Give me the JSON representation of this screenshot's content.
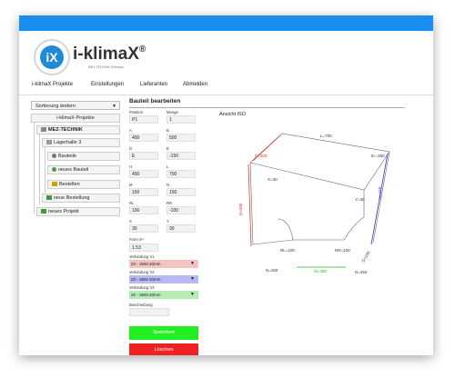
{
  "app": {
    "logo_text": "i-klimaX",
    "logo_reg": "®",
    "logo_glyph": "iX",
    "logo_subtitle": "MEZ-TECHNIK Software"
  },
  "colors": {
    "topbar": "#1a8ef0",
    "save": "#22ee22",
    "delete": "#ee2222",
    "v1": "#f6c3c3",
    "v2": "#b8b8f2",
    "v3": "#b4ecb4"
  },
  "nav": [
    "i-klimaX Projekte",
    "Einstellungen",
    "Lieferanten",
    "Abmelden"
  ],
  "sidebar": {
    "sort_label": "Sortierung ändern",
    "tree": [
      {
        "label": "i-klimaX-Projekte",
        "icon": "none"
      },
      {
        "label": "MEZ-TECHNIK",
        "icon": "building-icon"
      },
      {
        "label": "Lagerhalle 3",
        "icon": "folder-icon"
      },
      {
        "label": "Bauteile",
        "icon": "part-icon"
      },
      {
        "label": "neues Bauteil",
        "icon": "add-part-icon"
      },
      {
        "label": "Bestellen",
        "icon": "cart-icon"
      },
      {
        "label": "neue Bestellung",
        "icon": "add-order-icon"
      },
      {
        "label": "neues Projekt",
        "icon": "add-project-icon"
      }
    ]
  },
  "form": {
    "title": "Bauteil bearbeiten",
    "fields": [
      {
        "label": "Position",
        "value": "P1"
      },
      {
        "label": "Menge",
        "value": "1"
      },
      {
        "label": "A",
        "value": "400"
      },
      {
        "label": "B",
        "value": "500"
      },
      {
        "label": "D",
        "value": "E"
      },
      {
        "label": "E",
        "value": "-150"
      },
      {
        "label": "H",
        "value": "400"
      },
      {
        "label": "L",
        "value": "700"
      },
      {
        "label": "M",
        "value": "150"
      },
      {
        "label": "N",
        "value": "150"
      },
      {
        "label": "RL",
        "value": "100"
      },
      {
        "label": "RR",
        "value": "-100"
      },
      {
        "label": "X",
        "value": "30"
      },
      {
        "label": "Y",
        "value": "30"
      }
    ],
    "form_label": "Form m²",
    "form_value": "1.53",
    "v1_label": "Verbindung V1",
    "v1_value": "20 - SBM 20mm",
    "v2_label": "Verbindung V2",
    "v2_value": "20 - SBM 20mm",
    "v3_label": "Verbindung V3",
    "v3_value": "20 - SBM 20mm",
    "desc_label": "Beschreibung",
    "desc_value": "",
    "save_label": "Speichern",
    "delete_label": "Löschen"
  },
  "view": {
    "title": "Ansicht ISO",
    "labels": {
      "L": "L=700",
      "E": "E=-250",
      "D": "D=400",
      "X": "X=30",
      "B": "B=500",
      "Y": "Y=30",
      "H": "H=150",
      "D2": "D=150",
      "RL": "RL=100",
      "RR": "RR=100",
      "N": "N=250",
      "M": "M=400",
      "N2": "N=250"
    }
  }
}
